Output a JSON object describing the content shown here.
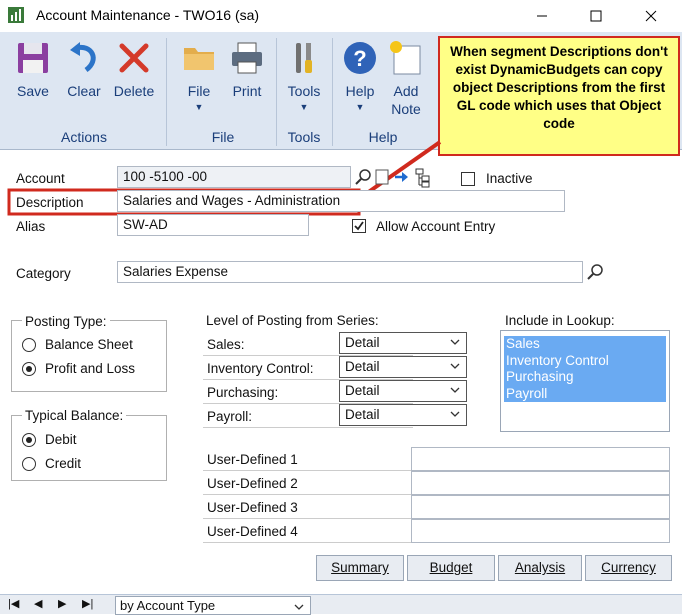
{
  "window": {
    "title": "Account Maintenance  -  TWO16 (sa)"
  },
  "ribbon": {
    "buttons": {
      "save": "Save",
      "clear": "Clear",
      "delete": "Delete",
      "file": "File",
      "print": "Print",
      "tools": "Tools",
      "help": "Help",
      "add_note_1": "Add",
      "add_note_2": "Note"
    },
    "groups": {
      "actions": "Actions",
      "file": "File",
      "tools": "Tools",
      "help": "Help"
    }
  },
  "callout": {
    "text": "When segment Descriptions don't exist DynamicBudgets can copy object Descriptions from the first GL code which uses that Object code"
  },
  "form": {
    "account_label": "Account",
    "account_value": "100 -5100 -00",
    "inactive_label": "Inactive",
    "description_label": "Description",
    "description_value": "Salaries and Wages - Administration",
    "alias_label": "Alias",
    "alias_value": "SW-AD",
    "allow_entry_label": "Allow Account Entry",
    "category_label": "Category",
    "category_value": "Salaries Expense"
  },
  "posting_type": {
    "title": "Posting Type:",
    "balance_sheet": "Balance Sheet",
    "profit_and_loss": "Profit and Loss"
  },
  "typical_balance": {
    "title": "Typical Balance:",
    "debit": "Debit",
    "credit": "Credit"
  },
  "level_of_posting": {
    "title": "Level of Posting from Series:",
    "rows": [
      {
        "label": "Sales:",
        "value": "Detail"
      },
      {
        "label": "Inventory Control:",
        "value": "Detail"
      },
      {
        "label": "Purchasing:",
        "value": "Detail"
      },
      {
        "label": "Payroll:",
        "value": "Detail"
      }
    ]
  },
  "lookup": {
    "title": "Include in Lookup:",
    "items": [
      "Sales",
      "Inventory Control",
      "Purchasing",
      "Payroll"
    ]
  },
  "user_defined": [
    "User-Defined 1",
    "User-Defined 2",
    "User-Defined 3",
    "User-Defined 4"
  ],
  "bottom_buttons": {
    "summary": "Summary",
    "budget": "Budget",
    "analysis": "Analysis",
    "currency": "Currency"
  },
  "nav": {
    "sort": "by Account Type"
  },
  "colors": {
    "callout_border": "#d02a1e",
    "callout_bg": "#ffff86",
    "highlight": "#6aaaf2",
    "ribbon_text": "#1a3e7a"
  }
}
